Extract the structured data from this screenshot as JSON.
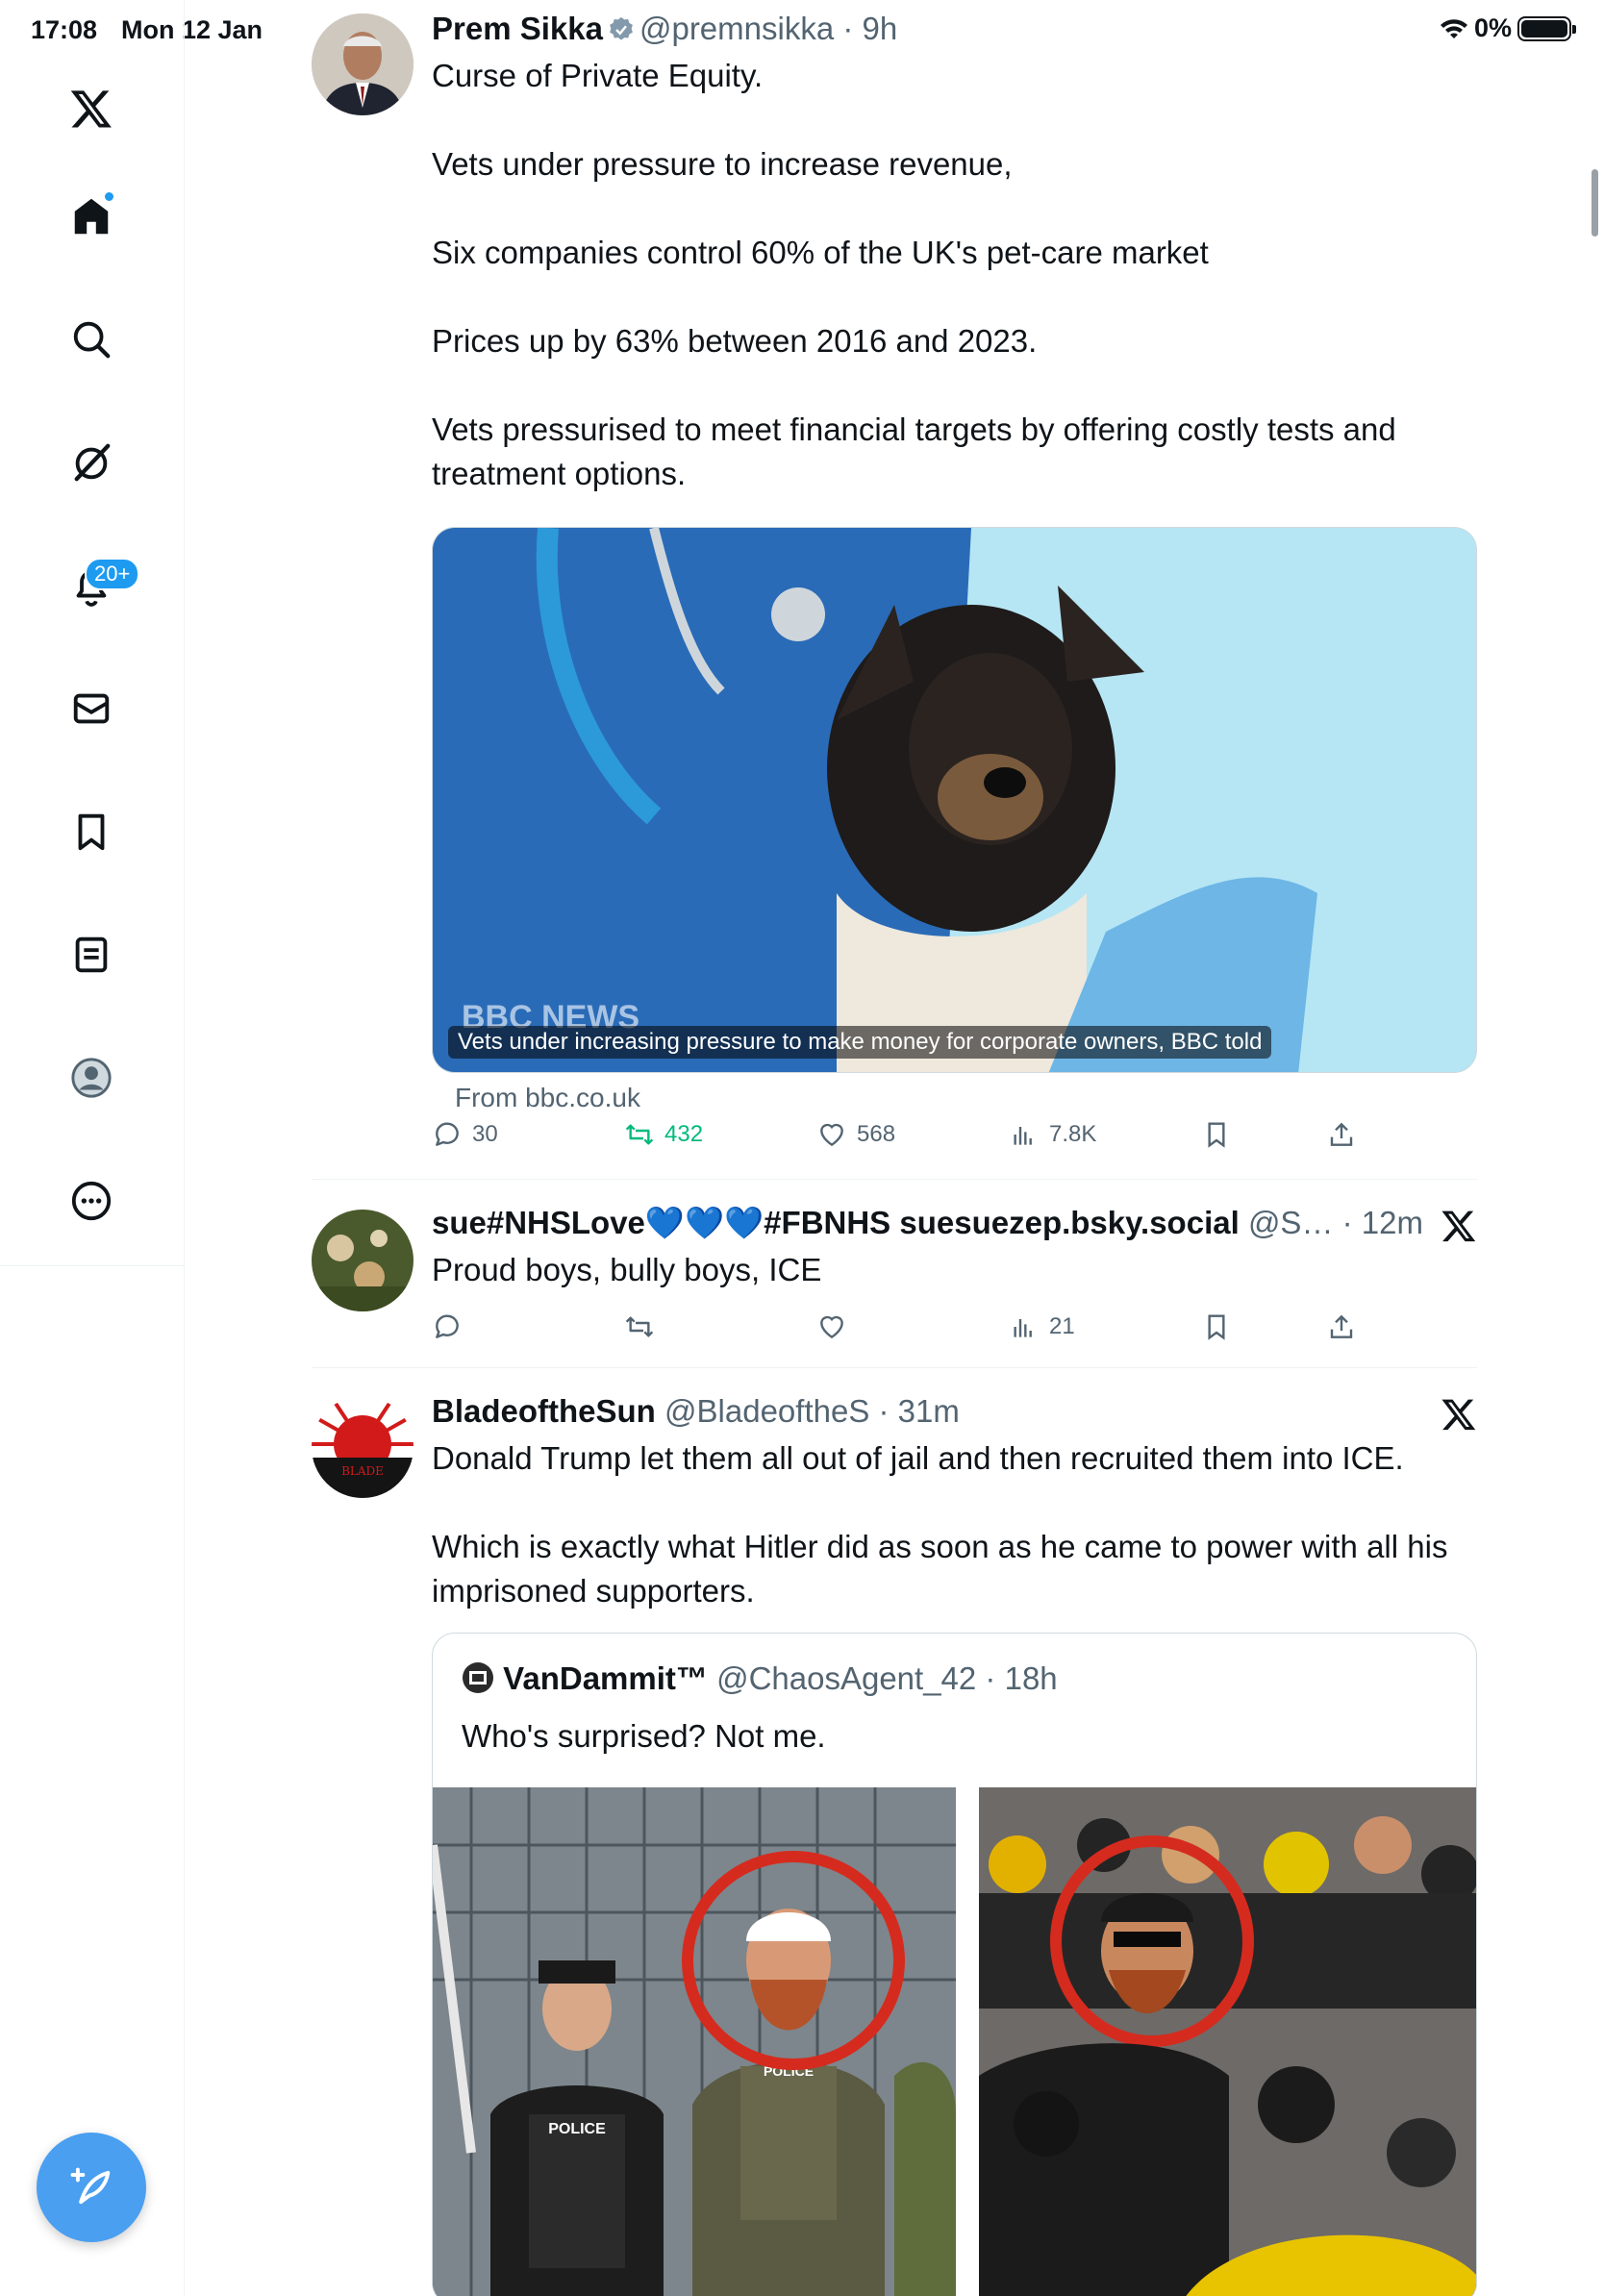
{
  "status_bar": {
    "time": "17:08",
    "date": "Mon 12 Jan",
    "battery": "0%"
  },
  "sidebar": {
    "items": [
      {
        "name": "x-logo-icon"
      },
      {
        "name": "home-icon"
      },
      {
        "name": "search-icon"
      },
      {
        "name": "grok-icon"
      },
      {
        "name": "notifications-icon",
        "badge": "20+"
      },
      {
        "name": "messages-icon"
      },
      {
        "name": "bookmarks-icon"
      },
      {
        "name": "lists-icon"
      },
      {
        "name": "profile-icon"
      },
      {
        "name": "more-icon"
      }
    ]
  },
  "tweets": [
    {
      "name": "Prem Sikka",
      "handle": "@premnsikka",
      "time": "9h",
      "verified": true,
      "text": [
        "Curse of Private Equity.",
        "Vets under pressure to increase revenue,",
        "Six companies control 60% of the UK's pet-care market",
        "Prices up by 63% between 2016 and 2023.",
        "Vets pressurised to meet financial targets by offering costly tests and treatment options."
      ],
      "card": {
        "caption": "Vets under increasing pressure to make money for corporate owners, BBC told",
        "watermark": "BBC NEWS",
        "source": "From bbc.co.uk"
      },
      "stats": {
        "replies": "30",
        "reposts": "432",
        "likes": "568",
        "views": "7.8K"
      }
    },
    {
      "name": "sue#NHSLove💙💙💙#FBNHS suesuezep.bsky.social",
      "handle": "@S…",
      "time": "12m",
      "text": [
        "Proud boys, bully boys, ICE"
      ],
      "stats": {
        "replies": "",
        "reposts": "",
        "likes": "",
        "views": "21"
      }
    },
    {
      "name": "BladeoftheSun",
      "handle": "@BladeoftheS",
      "time": "31m",
      "text": [
        "Donald Trump let them all out of jail and then recruited them into ICE.",
        "Which is exactly what Hitler did as soon as he came to power with all his imprisoned supporters."
      ],
      "quote": {
        "name": "VanDammit™",
        "handle": "@ChaosAgent_42",
        "time": "18h",
        "text": "Who's surprised? Not me.",
        "img_left_label": "POLICE",
        "img_left_vest": "POLICE"
      }
    }
  ],
  "colors": {
    "accent": "#1d9bf0",
    "repost": "#00ba7c",
    "muted": "#536471"
  }
}
